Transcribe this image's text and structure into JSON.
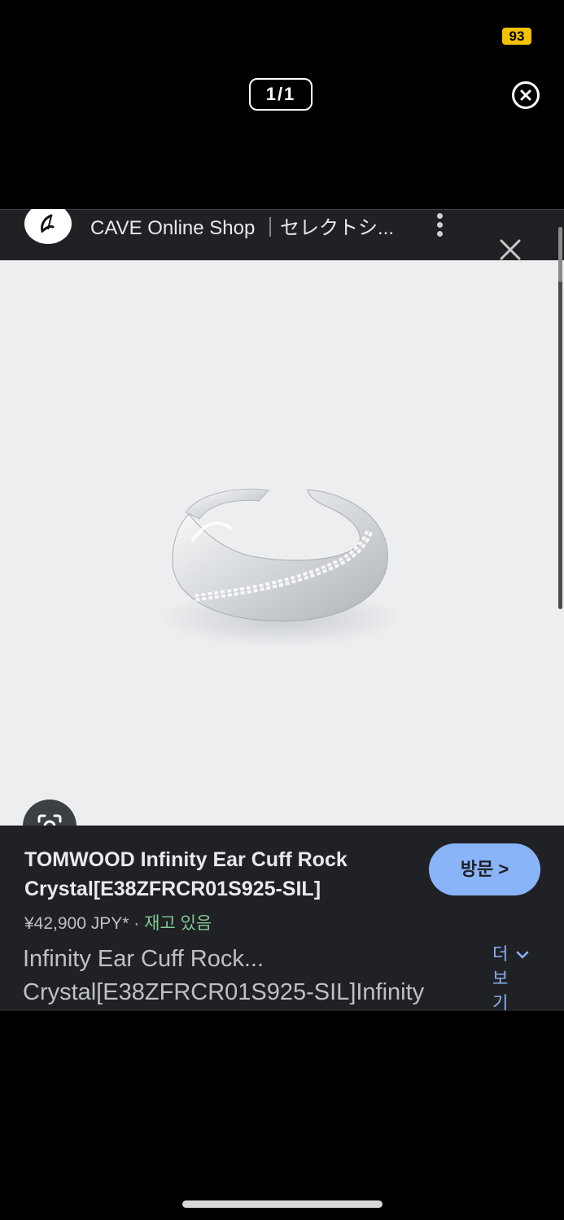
{
  "status": {
    "battery": "93"
  },
  "viewer": {
    "counter": "1/1"
  },
  "site": {
    "name": "CAVE Online Shop ｜セレクトシ..."
  },
  "product": {
    "title_line1": "TOMWOOD Infinity Ear Cuff Rock",
    "title_line2": "Crystal[E38ZFRCR01S925-SIL]",
    "price": "¥42,900 JPY*",
    "separator": "·",
    "stock": "재고 있음",
    "visit_label": "방문 >",
    "desc_line1": "Infinity Ear Cuff Rock...",
    "desc_line2": "Crystal[E38ZFRCR01S925-SIL]Infinity",
    "more_label_1": "더",
    "more_label_2": "보",
    "more_label_3": "기"
  },
  "icons": {
    "close_viewer": "close-circle-icon",
    "close_panel": "close-icon",
    "menu": "kebab-menu-icon",
    "lens": "lens-search-icon",
    "more": "chevron-down-icon"
  },
  "colors": {
    "background": "#000000",
    "panel": "#202124",
    "image_bg": "#eceef0",
    "accent": "#8ab4f8",
    "stock_green": "#81c995",
    "battery": "#f2c200"
  }
}
